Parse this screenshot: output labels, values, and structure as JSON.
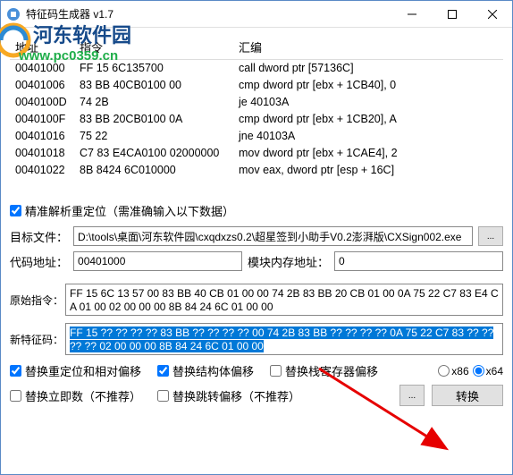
{
  "window": {
    "title": "特征码生成器 v1.7"
  },
  "watermark": {
    "line1": "河东软件园",
    "line2": "www.pc0359.cn"
  },
  "table": {
    "headers": {
      "addr": "地址",
      "instr": "指令",
      "asm": "汇编"
    },
    "rows": [
      {
        "addr": "00401000",
        "instr": "FF 15 6C135700",
        "asm": "call dword ptr [57136C]"
      },
      {
        "addr": "00401006",
        "instr": "83 BB 40CB0100 00",
        "asm": "cmp dword ptr [ebx + 1CB40], 0"
      },
      {
        "addr": "0040100D",
        "instr": "74 2B",
        "asm": "je 40103A"
      },
      {
        "addr": "0040100F",
        "instr": "83 BB 20CB0100 0A",
        "asm": "cmp dword ptr [ebx + 1CB20], A"
      },
      {
        "addr": "00401016",
        "instr": "75 22",
        "asm": "jne 40103A"
      },
      {
        "addr": "00401018",
        "instr": "C7 83 E4CA0100 02000000",
        "asm": "mov dword ptr [ebx + 1CAE4], 2"
      },
      {
        "addr": "00401022",
        "instr": "8B 8424 6C010000",
        "asm": "mov eax, dword ptr [esp + 16C]"
      }
    ]
  },
  "form": {
    "parse_reloc_label": "精准解析重定位（需准确输入以下数据）",
    "target_file_label": "目标文件：",
    "target_file_value": "D:\\tools\\桌面\\河东软件园\\cxqdxzs0.2\\超星签到小助手V0.2澎湃版\\CXSign002.exe",
    "browse": "...",
    "code_addr_label": "代码地址：",
    "code_addr_value": "00401000",
    "module_addr_label": "模块内存地址：",
    "module_addr_value": "0",
    "orig_instr_label": "原始指令：",
    "orig_instr_value": "FF 15 6C 13 57 00 83 BB 40 CB 01 00 00 74 2B 83 BB 20 CB 01 00 0A 75 22 C7 83 E4 CA 01 00 02 00 00 00 8B 84 24 6C 01 00 00",
    "new_sig_label": "新特征码：",
    "new_sig_value": "FF 15 ?? ?? ?? ?? 83 BB ?? ?? ?? ?? 00 74 2B 83 BB ?? ?? ?? ?? 0A 75 22 C7 83 ?? ?? ?? ?? 02 00 00 00 8B 84 24 6C 01 00 00"
  },
  "options": {
    "replace_reloc": "替换重定位和相对偏移",
    "replace_struct": "替换结构体偏移",
    "replace_stack": "替换栈寄存器偏移",
    "replace_imm": "替换立即数（不推荐）",
    "replace_jmp": "替换跳转偏移（不推荐）",
    "x86": "x86",
    "x64": "x64",
    "convert": "转换",
    "more": "..."
  }
}
